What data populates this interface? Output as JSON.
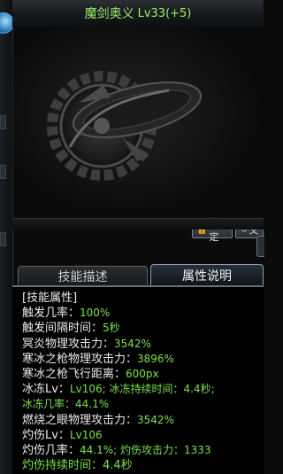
{
  "skill": {
    "name": "魔剑奥义",
    "level": "Lv33(+5)"
  },
  "buttons": {
    "lock_label": "锁定",
    "other_label": "交"
  },
  "tabs": [
    {
      "label": "技能描述"
    },
    {
      "label": "属性说明"
    }
  ],
  "properties": {
    "header": "[技能属性]",
    "l1_label": "触发几率：",
    "l1_value": "100%",
    "l2_label": "触发间隔时间：",
    "l2_value": "5秒",
    "l3_label": "冥炎物理攻击力：",
    "l3_value": "3542%",
    "l4_label": "寒冰之枪物理攻击力：",
    "l4_value": "3896%",
    "l5_label": "寒冰之枪飞行距离：",
    "l5_value": "600px",
    "l6_label": "冰冻Lv：",
    "l6_value": "Lv106; 冰冻持续时间：4.4秒;",
    "l7_value": "冰冻几率：44.1%",
    "l8_label": "燃烧之眼物理攻击力：",
    "l8_value": "3542%",
    "l9_label": "灼伤Lv：",
    "l9_value": "Lv106",
    "l10_label": "灼伤几率：",
    "l10_value": "44.1%; 灼伤攻击力：1333",
    "l11_partial": "灼伤持续时间：4.4秒"
  },
  "colors": {
    "title_green": "#9cf06a",
    "value_green": "#7ae24c",
    "label_white": "#ececec"
  },
  "icons": {
    "lock": "lock-icon",
    "orb": "orb-icon",
    "emblem": "skill-emblem-icon"
  }
}
